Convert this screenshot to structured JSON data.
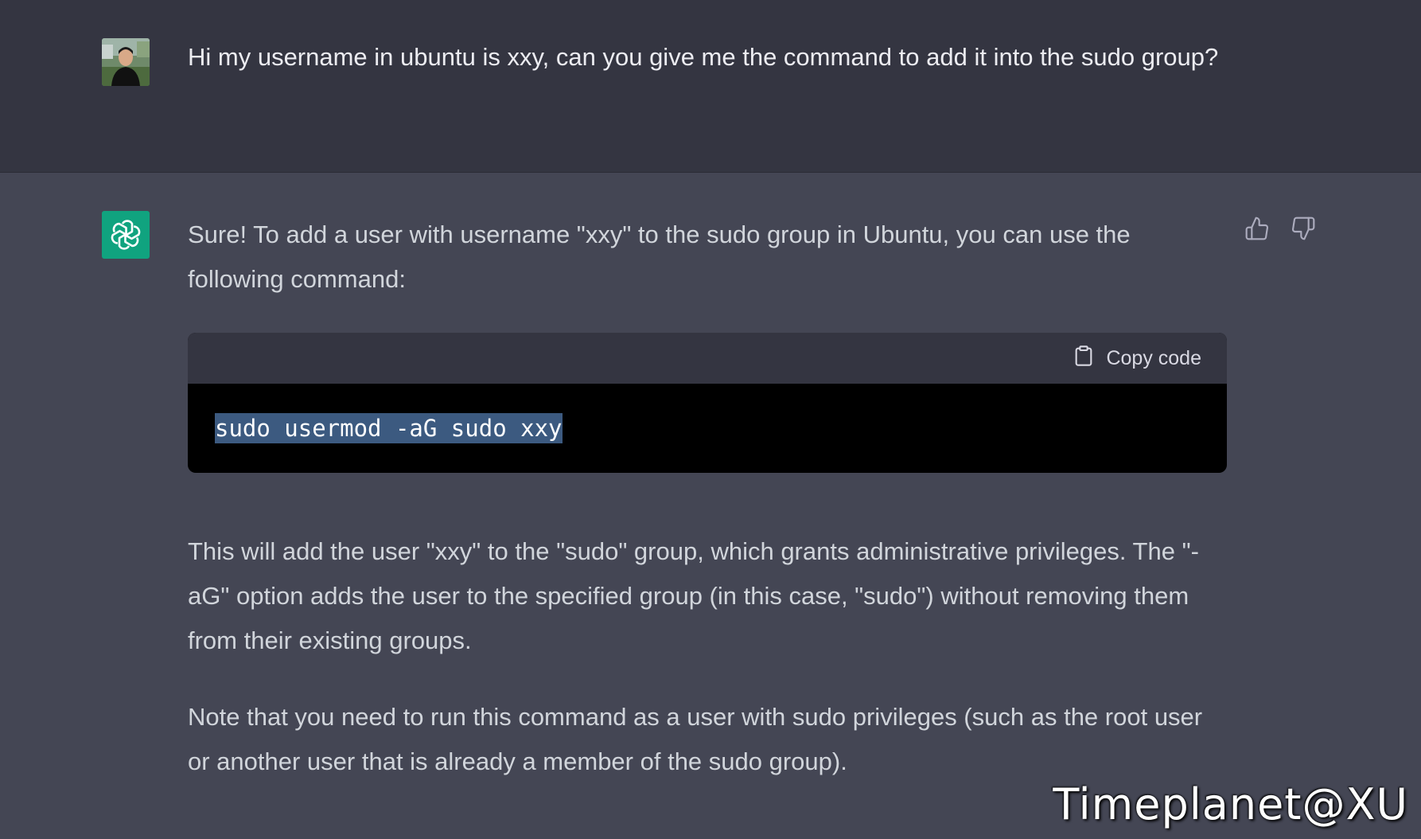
{
  "user_message": {
    "text": "Hi my username in ubuntu is xxy, can you give me the command to add it into the sudo group?"
  },
  "assistant_message": {
    "intro": "Sure! To add a user with username \"xxy\" to the sudo group in Ubuntu, you can use the following command:",
    "code_block": {
      "copy_label": "Copy code",
      "code": "sudo usermod -aG sudo xxy"
    },
    "explanation": "This will add the user \"xxy\" to the \"sudo\" group, which grants administrative privileges. The \"-aG\" option adds the user to the specified group (in this case, \"sudo\") without removing them from their existing groups.",
    "note": "Note that you need to run this command as a user with sudo privileges (such as the root user or another user that is already a member of the sudo group)."
  },
  "icons": {
    "avatar": "user-avatar",
    "assistant": "openai-logo-icon",
    "copy": "clipboard-icon",
    "like": "thumbs-up-icon",
    "dislike": "thumbs-down-icon"
  },
  "colors": {
    "user_bg": "#343541",
    "assistant_bg": "#444654",
    "logo_bg": "#10a37f",
    "code_bg": "#000000",
    "selection": "#3c5a80"
  },
  "watermark": "Timeplanet@XU"
}
